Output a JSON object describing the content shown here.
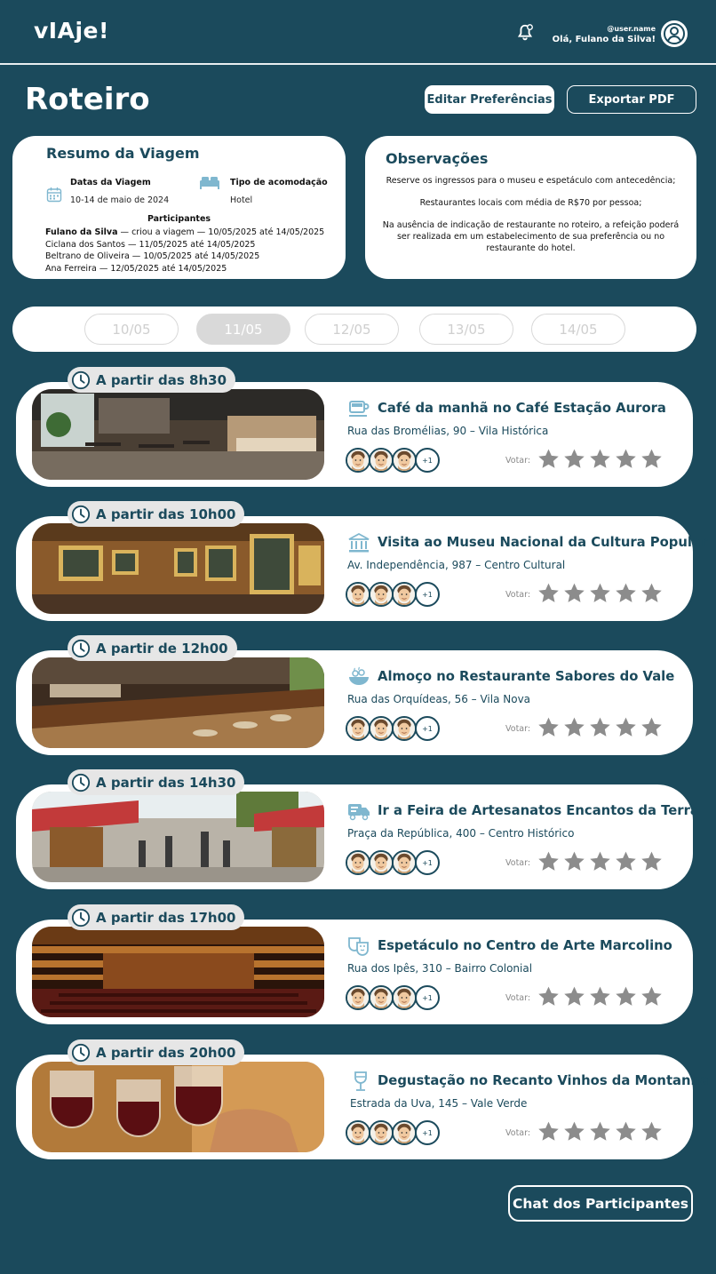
{
  "header": {
    "logo": "vIAje!",
    "user_handle": "@user.name",
    "greeting": "Olá, Fulano da Silva!"
  },
  "page": {
    "title": "Roteiro",
    "edit_button": "Editar Preferências",
    "export_button": "Exportar PDF"
  },
  "summary": {
    "title": "Resumo da Viagem",
    "dates_label": "Datas da Viagem",
    "dates_value": "10-14 de maio de 2024",
    "accommodation_label": "Tipo de acomodação",
    "accommodation_value": "Hotel",
    "participants_title": "Participantes",
    "participants": [
      {
        "name": "Fulano da Silva",
        "text": " — criou a viagem — 10/05/2025 até 14/05/2025"
      },
      {
        "name": "",
        "text": "Ciclana dos Santos — 11/05/2025 até 14/05/2025"
      },
      {
        "name": "",
        "text": "Beltrano de Oliveira — 10/05/2025 até 14/05/2025"
      },
      {
        "name": "",
        "text": "Ana Ferreira — 12/05/2025 até 14/05/2025"
      }
    ]
  },
  "observations": {
    "title": "Observações",
    "items": [
      "Reserve os ingressos para o museu e espetáculo com antecedência;",
      "Restaurantes locais com média de R$70 por pessoa;",
      "Na ausência de indicação de restaurante no roteiro, a refeição poderá ser realizada em um estabelecimento de sua preferência ou no restaurante do hotel."
    ]
  },
  "date_tabs": {
    "tabs": [
      "10/05",
      "11/05",
      "12/05",
      "13/05",
      "14/05"
    ],
    "selected": "11/05"
  },
  "activities": [
    {
      "time": "A partir das 8h30",
      "icon": "coffee-cup-icon",
      "title": "Café da manhã no Café Estação Aurora",
      "address": "Rua das Bromélias, 90 – Vila Histórica",
      "extra": "+1",
      "vote_label": "Votar:"
    },
    {
      "time": "A partir das 10h00",
      "icon": "museum-icon",
      "title": "Visita ao Museu Nacional da Cultura Popular",
      "address": "Av. Independência, 987 – Centro Cultural",
      "extra": "+1",
      "vote_label": "Votar:"
    },
    {
      "time": "A partir de 12h00",
      "icon": "food-bowl-icon",
      "title": "Almoço no Restaurante Sabores do Vale",
      "address": "Rua das Orquídeas, 56 – Vila Nova",
      "extra": "+1",
      "vote_label": "Votar:"
    },
    {
      "time": "A partir das 14h30",
      "icon": "truck-icon",
      "title": "Ir a Feira de Artesanatos Encantos da Terra",
      "address": "Praça da República, 400 – Centro Histórico",
      "extra": "+1",
      "vote_label": "Votar:"
    },
    {
      "time": "A partir das 17h00",
      "icon": "theater-masks-icon",
      "title": "Espetáculo no Centro de Arte Marcolino",
      "address": "Rua dos Ipês, 310 – Bairro Colonial",
      "extra": "+1",
      "vote_label": "Votar:"
    },
    {
      "time": "A partir das 20h00",
      "icon": "wine-glass-icon",
      "title": "Degustação no Recanto Vinhos da Montanha",
      "address": "Estrada da Uva, 145 – Vale Verde",
      "extra": "+1",
      "vote_label": "Votar:"
    }
  ],
  "chat_button": "Chat dos Participantes",
  "colors": {
    "background": "#1b4a5c",
    "card": "#ffffff",
    "star": "#8c8c8c",
    "tab_inactive": "#d9d9d9"
  }
}
